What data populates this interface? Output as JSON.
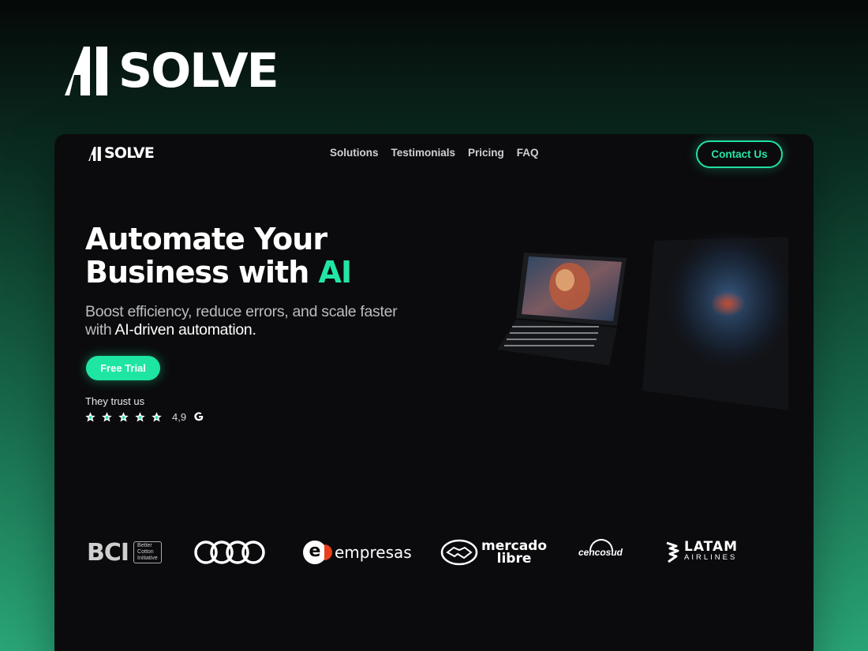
{
  "brand": {
    "ai": "AI",
    "name": "SOLVE"
  },
  "nav": {
    "links": [
      "Solutions",
      "Testimonials",
      "Pricing",
      "FAQ"
    ],
    "contact_label": "Contact Us"
  },
  "hero": {
    "title_line1": "Automate Your",
    "title_line2_prefix": "Business with ",
    "title_accent": "AI",
    "subtitle_part1": "Boost efficiency, reduce errors, and scale faster with ",
    "subtitle_strong": "AI-driven automation.",
    "cta_label": "Free Trial",
    "trust_label": "They trust us",
    "rating": "4,9",
    "stars": 5,
    "review_source_icon": "google-icon"
  },
  "logos": {
    "bci": {
      "mark": "BCI",
      "caption_lines": [
        "Better",
        "Cotton",
        "Initiative"
      ]
    },
    "audi": {
      "icon": "audi-rings-icon"
    },
    "entel": {
      "mark": "e",
      "text": "empresas"
    },
    "mercado_libre": {
      "line1": "mercado",
      "line2": "libre"
    },
    "cencosud": {
      "text": "cencosud"
    },
    "latam": {
      "line1": "LATAM",
      "line2": "AIRLINES"
    }
  },
  "colors": {
    "accent": "#22e6a6",
    "card_bg": "#0b0b0d",
    "page_gradient_top": "#050807",
    "page_gradient_bottom": "#2aa577"
  }
}
